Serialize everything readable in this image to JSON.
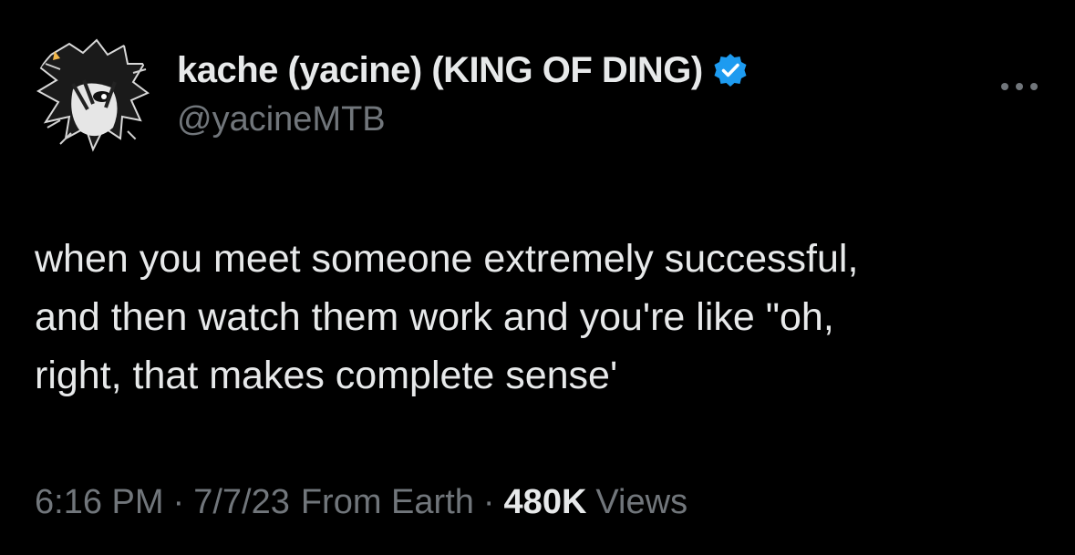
{
  "tweet": {
    "display_name": "kache (yacine) (KING OF DING)",
    "handle": "@yacineMTB",
    "verified": true,
    "text": "when you meet someone extremely successful,\nand then watch them work and you're like \"oh,\nright, that makes complete sense'",
    "time": "6:16 PM",
    "date": "7/7/23",
    "separator": "·",
    "source": "From Earth",
    "views_count": "480K",
    "views_label": "Views"
  },
  "icons": {
    "verified": "verified-badge-icon",
    "more": "more-options-icon",
    "avatar": "anime-avatar"
  },
  "colors": {
    "background": "#000000",
    "primary_text": "#e7e9ea",
    "secondary_text": "#71767b",
    "verified_blue": "#1d9bf0"
  }
}
